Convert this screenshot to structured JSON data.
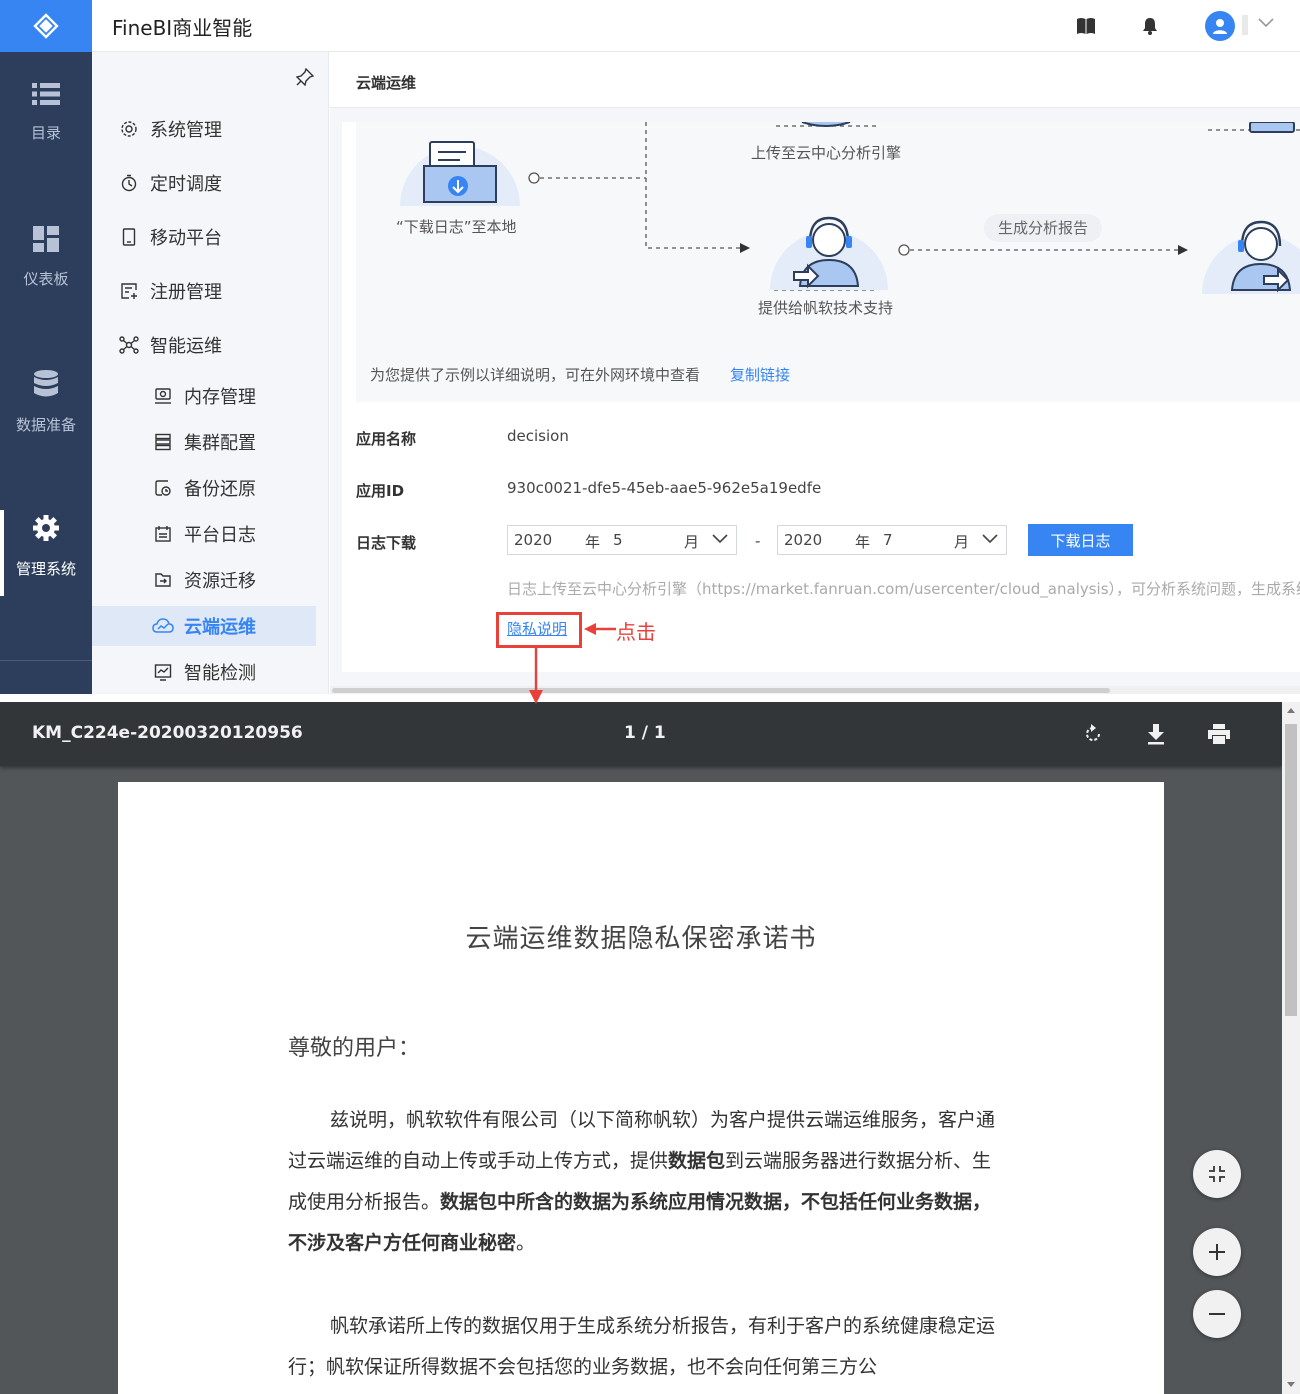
{
  "app": {
    "title": "FineBI商业智能"
  },
  "left_nav": [
    {
      "label": "目录",
      "icon": "list-icon"
    },
    {
      "label": "仪表板",
      "icon": "dashboard-icon"
    },
    {
      "label": "数据准备",
      "icon": "database-icon"
    },
    {
      "label": "管理系统",
      "icon": "gear-icon",
      "active": true
    }
  ],
  "sub_nav": [
    {
      "label": "系统管理",
      "icon": "settings-icon"
    },
    {
      "label": "定时调度",
      "icon": "timer-icon"
    },
    {
      "label": "移动平台",
      "icon": "mobile-icon"
    },
    {
      "label": "注册管理",
      "icon": "register-icon"
    },
    {
      "label": "智能运维",
      "icon": "network-icon"
    },
    {
      "label": "内存管理",
      "icon": "memory-icon"
    },
    {
      "label": "集群配置",
      "icon": "cluster-icon"
    },
    {
      "label": "备份还原",
      "icon": "backup-icon"
    },
    {
      "label": "平台日志",
      "icon": "calendar-icon"
    },
    {
      "label": "资源迁移",
      "icon": "migrate-icon"
    },
    {
      "label": "云端运维",
      "icon": "cloud-ops-icon",
      "active": true
    },
    {
      "label": "智能检测",
      "icon": "detect-icon"
    }
  ],
  "content": {
    "title": "云端运维",
    "diagram": {
      "download_label": "“下载日志”至本地",
      "upload_label": "上传至云中心分析引擎",
      "support_label": "提供给帆软技术支持",
      "report_label": "生成分析报告"
    },
    "tip_text": "为您提供了示例以详细说明，可在外网环境中查看",
    "copy_link": "复制链接",
    "fields": {
      "app_name_label": "应用名称",
      "app_name_value": "decision",
      "app_id_label": "应用ID",
      "app_id_value": "930c0021-dfe5-45eb-aae5-962e5a19edfe",
      "log_label": "日志下载"
    },
    "date_start": {
      "year": "2020",
      "year_unit": "年",
      "month": "5",
      "month_unit": "月"
    },
    "date_end": {
      "year": "2020",
      "year_unit": "年",
      "month": "7",
      "month_unit": "月"
    },
    "range_separator": "-",
    "download_button": "下载日志",
    "upload_note": "日志上传至云中心分析引擎（https://market.fanruan.com/usercenter/cloud_analysis），可分析系统问题，生成系统",
    "privacy_link": "隐私说明"
  },
  "annotation": {
    "click_text": "点击",
    "color": "#e8403b"
  },
  "viewer": {
    "doc_name": "KM_C224e-20200320120956",
    "page_count": "1 / 1",
    "title": "云端运维数据隐私保密承诺书",
    "salutation": "尊敬的用户：",
    "p1_a": "兹说明，帆软软件有限公司（以下简称帆软）为客户提供云端运维服务，客户通过云端运维的自动上传或手动上传方式，提供",
    "p1_b": "数据包",
    "p1_c": "到云端服务器进行数据分析、生成使用分析报告。",
    "p1_d": "数据包中所含的数据为系统应用情况数据，不包括任何业务数据，不涉及客户方任何商业秘密",
    "p1_e": "。",
    "p2": "帆软承诺所上传的数据仅用于生成系统分析报告，有利于客户的系统健康稳定运行；帆软保证所得数据不会包括您的业务数据，也不会向任何第三方公"
  },
  "colors": {
    "brand": "#3685f2",
    "nav_dark": "#2d3e5c",
    "viewer_bar": "#323639",
    "viewer_bg": "#525659"
  }
}
